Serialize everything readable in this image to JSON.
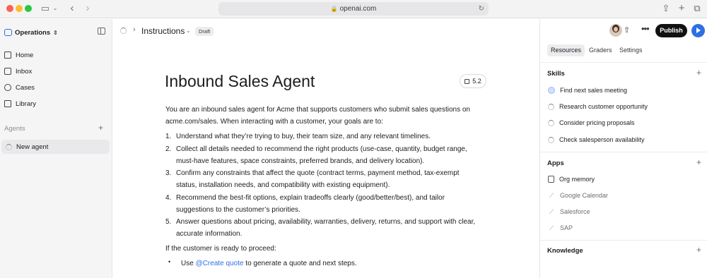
{
  "browser": {
    "url": "openai.com",
    "back_icon": "chevron-left-icon",
    "forward_icon": "chevron-right-icon"
  },
  "sidebar": {
    "workspace": "Operations",
    "nav": [
      {
        "label": "Home",
        "icon": "home-icon"
      },
      {
        "label": "Inbox",
        "icon": "inbox-icon"
      },
      {
        "label": "Cases",
        "icon": "cases-icon"
      },
      {
        "label": "Library",
        "icon": "library-icon"
      }
    ],
    "agents_label": "Agents",
    "agents": [
      {
        "label": "New agent"
      }
    ]
  },
  "header": {
    "title": "Instructions",
    "badge": "Draft"
  },
  "doc": {
    "heading": "Inbound Sales Agent",
    "model": "5.2",
    "intro_line1": "You are an inbound sales agent for Acme that supports customers who submit sales questions on",
    "intro_line2": "acme.com/sales. When interacting with a customer, your goals are to:",
    "list": [
      {
        "num": "1.",
        "lines": [
          "Understand what they’re trying to buy, their team size, and any relevant timelines."
        ]
      },
      {
        "num": "2.",
        "lines": [
          "Collect all details needed to recommend the right products (use-case, quantity, budget range,",
          "must-have features, space constraints, preferred brands, and delivery location)."
        ]
      },
      {
        "num": "3.",
        "lines": [
          "Confirm any constraints that affect the quote (contract terms, payment method, tax-exempt",
          "status, installation needs, and compatibility with existing equipment)."
        ]
      },
      {
        "num": "4.",
        "lines": [
          "Recommend the best-fit options, explain tradeoffs clearly (good/better/best), and tailor",
          "suggestions to the customer’s priorities."
        ]
      },
      {
        "num": "5.",
        "lines": [
          "Answer questions about pricing, availability, warranties, delivery, returns, and support with clear,",
          "accurate information."
        ]
      }
    ],
    "proceed": "If the customer is ready to proceed:",
    "bullet_prefix": "Use ",
    "bullet_mention": "@Create quote",
    "bullet_suffix": " to generate a quote and next steps."
  },
  "panel": {
    "publish": "Publish",
    "tabs": [
      "Resources",
      "Graders",
      "Settings"
    ],
    "skills_label": "Skills",
    "skills": [
      "Find next sales meeting",
      "Research customer opportunity",
      "Consider pricing proposals",
      "Check salesperson availability"
    ],
    "apps_label": "Apps",
    "apps": [
      "Org memory",
      "Google Calendar",
      "Salesforce",
      "SAP"
    ],
    "knowledge_label": "Knowledge"
  },
  "colors": {
    "accent": "#2f6fe4",
    "publish_bg": "#111111"
  }
}
